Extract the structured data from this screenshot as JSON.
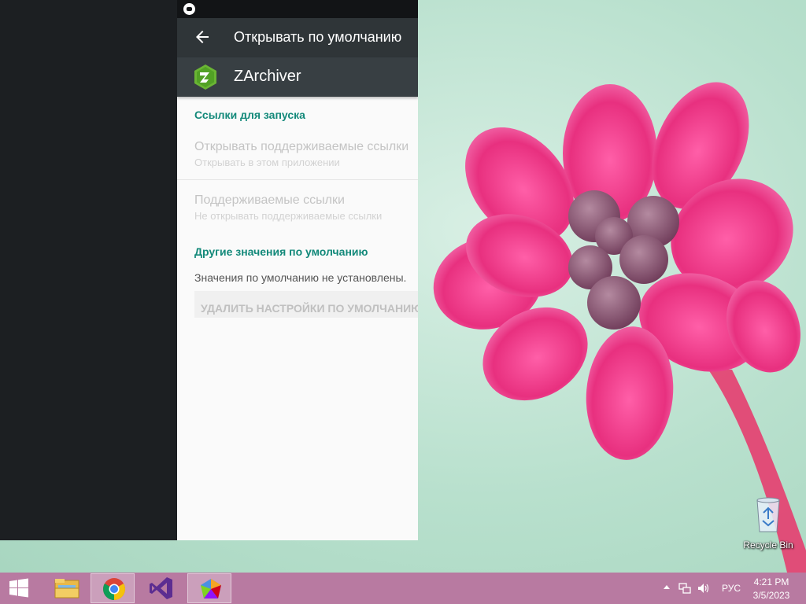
{
  "android": {
    "appbar_title": "Открывать по умолчанию",
    "app_name": "ZArchiver",
    "icons": {
      "back": "back-arrow-icon",
      "app": "zarchiver-icon",
      "status": "status-notification-icon"
    },
    "section_links": "Ссылки для запуска",
    "open_links_title": "Открывать поддерживаемые ссылки",
    "open_links_sub": "Открывать в этом приложении",
    "supported_links_title": "Поддерживаемые ссылки",
    "supported_links_sub": "Не открывать поддерживаемые ссылки",
    "section_other": "Другие значения по умолчанию",
    "no_defaults": "Значения по умолчанию не установлены.",
    "clear_defaults": "УДАЛИТЬ НАСТРОЙКИ ПО УМОЛЧАНИЮ",
    "colors": {
      "accent": "#13897a",
      "appbar": "#2f3538",
      "header": "#383f43"
    }
  },
  "desktop": {
    "recycle_bin_label": "Recycle Bin"
  },
  "taskbar": {
    "apps": [
      "start-button",
      "file-explorer",
      "chrome",
      "visual-studio",
      "emulator"
    ],
    "language": "РУС",
    "time": "4:21 PM",
    "date": "3/5/2023",
    "color": "#b87aa1"
  }
}
